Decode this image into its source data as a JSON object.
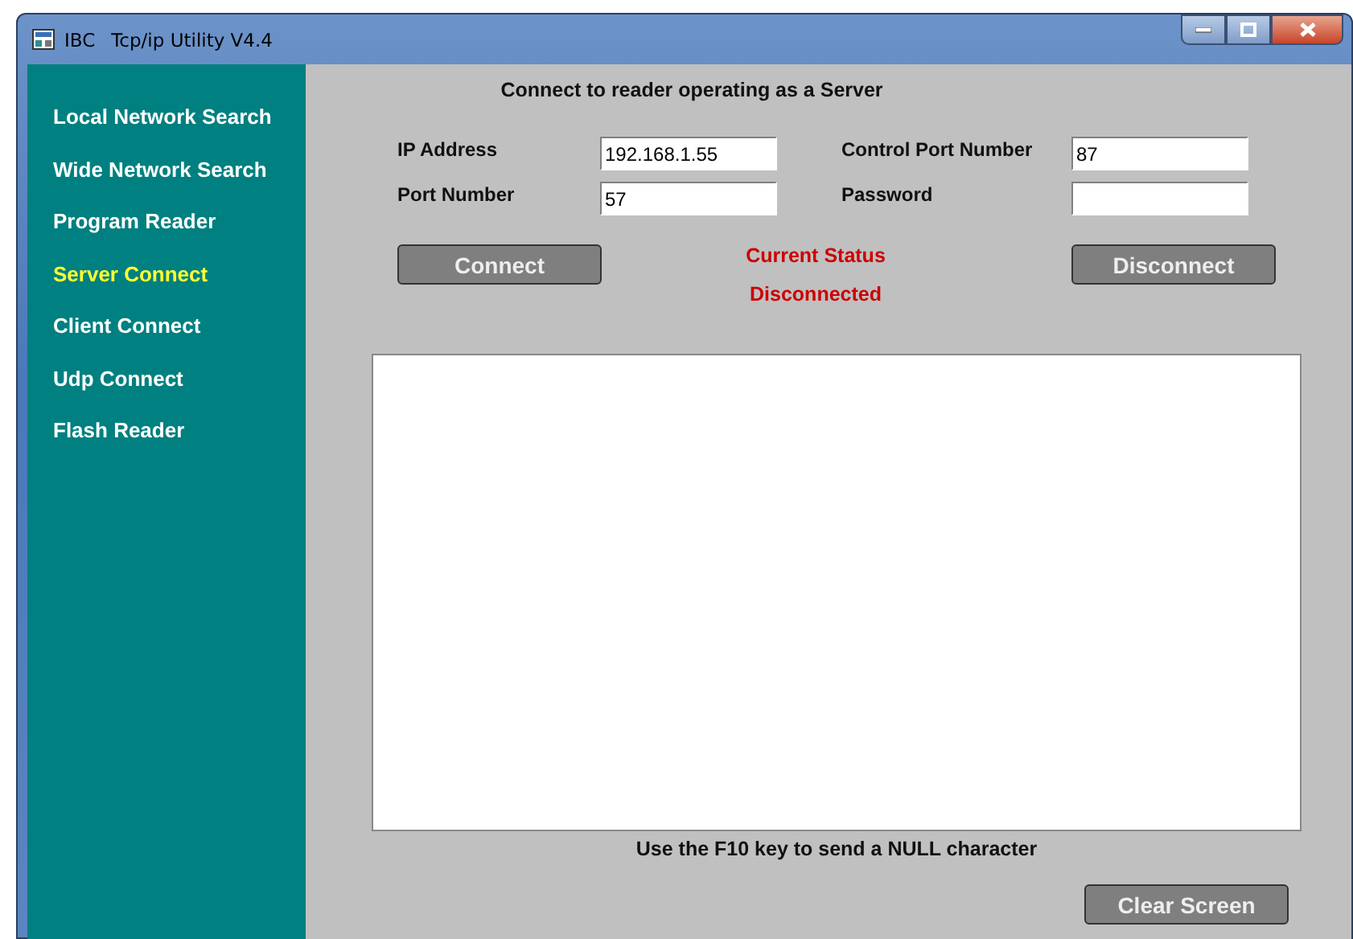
{
  "window": {
    "app": "IBC",
    "title": "Tcp/ip Utility V4.4"
  },
  "sidebar": {
    "items": [
      {
        "label": "Local Network Search",
        "selected": false
      },
      {
        "label": "Wide Network Search",
        "selected": false
      },
      {
        "label": "Program Reader",
        "selected": false
      },
      {
        "label": "Server Connect",
        "selected": true
      },
      {
        "label": "Client Connect",
        "selected": false
      },
      {
        "label": "Udp Connect",
        "selected": false
      },
      {
        "label": "Flash Reader",
        "selected": false
      }
    ]
  },
  "panel": {
    "heading": "Connect to reader operating as a Server",
    "fields": [
      {
        "label": "IP Address",
        "value": "192.168.1.55"
      },
      {
        "label": "Control Port Number",
        "value": "87"
      },
      {
        "label": "Port Number",
        "value": "57"
      },
      {
        "label": "Password"
      }
    ],
    "connect_button": "Connect",
    "disconnect_button": "Disconnect",
    "status": {
      "label": "Current Status",
      "value": "Disconnected"
    },
    "hint": "Use the F10 key to send a NULL character",
    "clear_button": "Clear Screen"
  }
}
